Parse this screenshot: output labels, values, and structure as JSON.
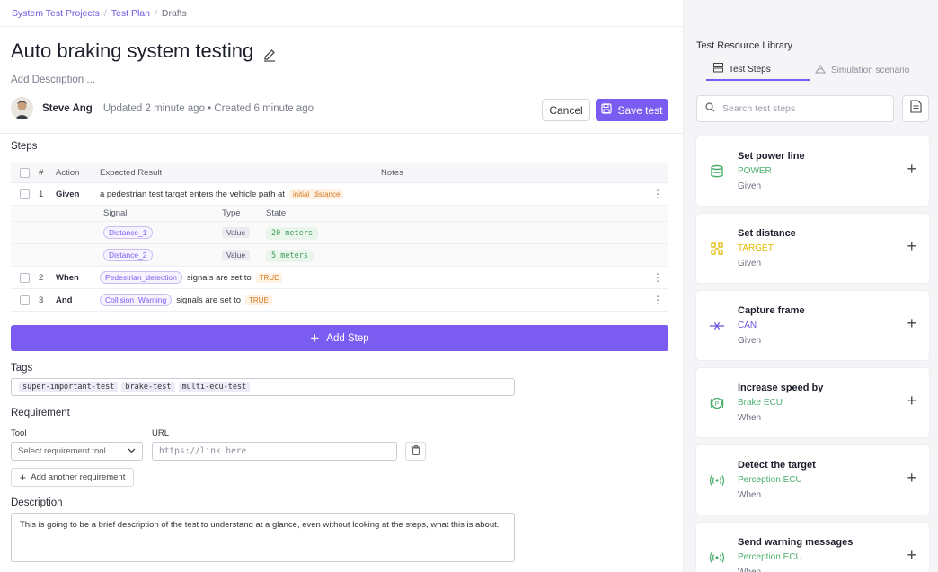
{
  "breadcrumb": {
    "items": [
      "System Test Projects",
      "Test Plan",
      "Drafts"
    ]
  },
  "page": {
    "title": "Auto braking system testing",
    "add_description": "Add Description ..."
  },
  "author": {
    "name": "Steve Ang",
    "meta": "Updated 2 minute ago • Created 6 minute ago"
  },
  "actions": {
    "cancel": "Cancel",
    "save": "Save test"
  },
  "steps": {
    "heading": "Steps",
    "columns": {
      "num": "#",
      "action": "Action",
      "expected": "Expected Result",
      "notes": "Notes"
    },
    "rows": [
      {
        "num": "1",
        "action": "Given",
        "text": "a pedestrian test target enters the vehicle path at",
        "chip": "initial_distance"
      },
      {
        "num": "2",
        "action": "When",
        "signal": "Pedestrian_detection",
        "text": "signals are set to",
        "chip": "TRUE"
      },
      {
        "num": "3",
        "action": "And",
        "signal": "Collision_Warning",
        "text": "signals are set to",
        "chip": "TRUE"
      }
    ],
    "subtable": {
      "columns": {
        "signal": "Signal",
        "type": "Type",
        "state": "State"
      },
      "rows": [
        {
          "signal": "Distance_1",
          "type": "Value",
          "state": "20 meters"
        },
        {
          "signal": "Distance_2",
          "type": "Value",
          "state": "5 meters"
        }
      ]
    },
    "add_label": "Add Step"
  },
  "tags": {
    "heading": "Tags",
    "items": [
      "super-important-test",
      "brake-test",
      "multi-ecu-test"
    ]
  },
  "requirement": {
    "heading": "Requirement",
    "tool_label": "Tool",
    "url_label": "URL",
    "tool_placeholder": "Select requirement tool",
    "url_placeholder": "https://link here",
    "add_another": "Add another requirement"
  },
  "description": {
    "heading": "Description",
    "text": "This is going to be a brief description of the test to understand at a glance, even without looking at the steps, what this is about."
  },
  "library": {
    "title": "Test Resource Library",
    "tabs": [
      "Test Steps",
      "Simulation scenario"
    ],
    "search_placeholder": "Search test steps",
    "cards": [
      {
        "title": "Set power line",
        "source": "POWER",
        "keyword": "Given",
        "color": "#4caf6e",
        "icon": "database-icon"
      },
      {
        "title": "Set distance",
        "source": "TARGET",
        "keyword": "Given",
        "color": "#e6b800",
        "icon": "target-grid-icon"
      },
      {
        "title": "Capture frame",
        "source": "CAN",
        "keyword": "Given",
        "color": "#6a55e0",
        "icon": "can-bus-icon"
      },
      {
        "title": "Increase speed by",
        "source": "Brake ECU",
        "keyword": "When",
        "color": "#4caf6e",
        "icon": "brake-icon"
      },
      {
        "title": "Detect the target",
        "source": "Perception ECU",
        "keyword": "When",
        "color": "#4caf6e",
        "icon": "signal-icon"
      },
      {
        "title": "Send warning messages",
        "source": "Perception ECU",
        "keyword": "When",
        "color": "#4caf6e",
        "icon": "signal-icon"
      }
    ]
  },
  "colors": {
    "accent": "#7b5cf0",
    "chip_orange": "#d27a22",
    "chip_green": "#3c9a55"
  }
}
